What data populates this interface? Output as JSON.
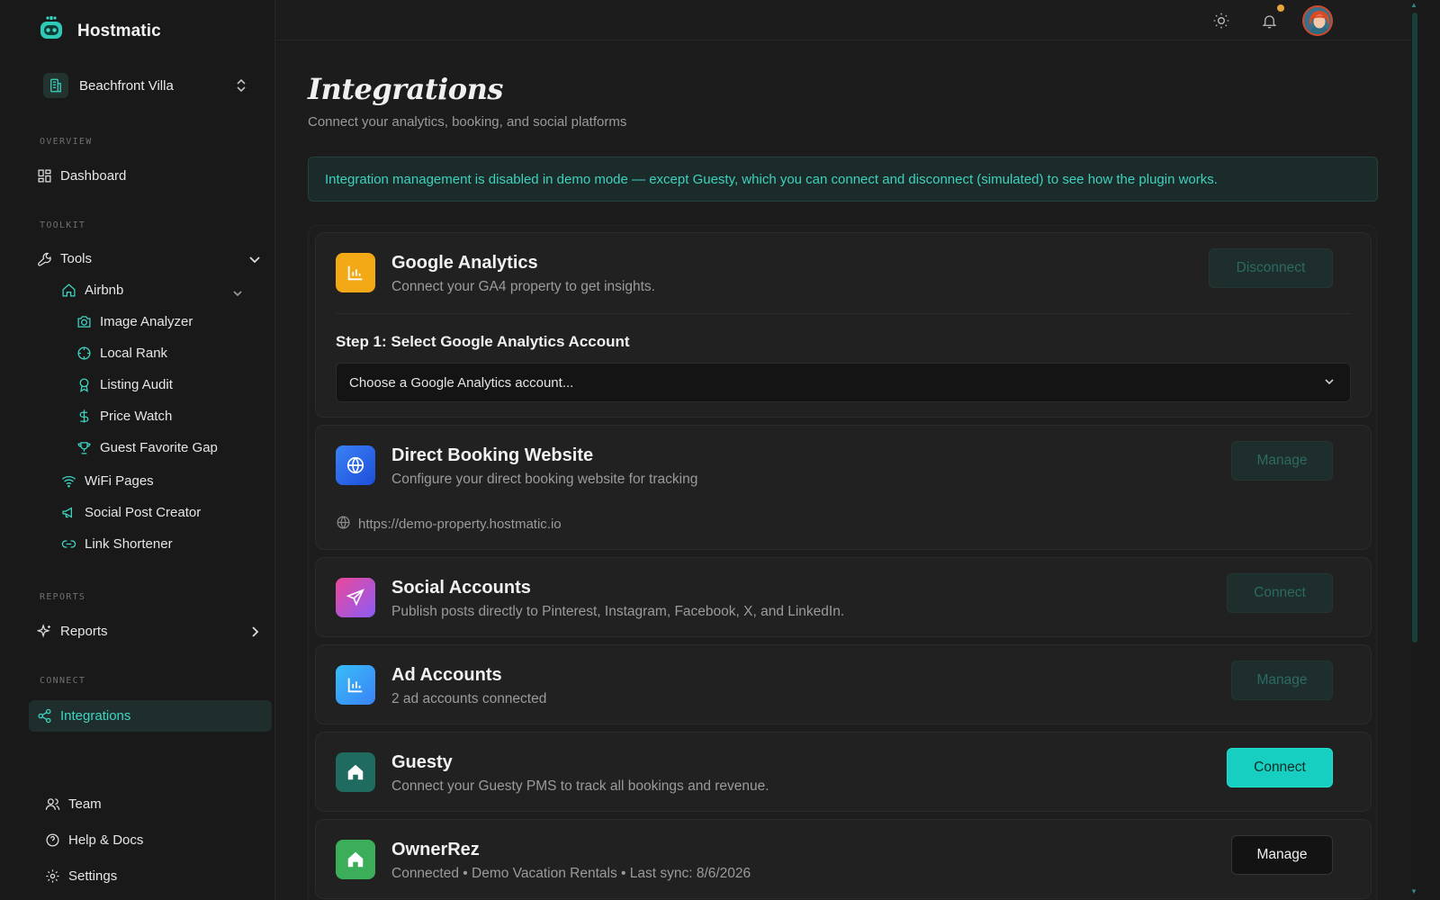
{
  "app": {
    "name": "Hostmatic"
  },
  "property": {
    "name": "Beachfront Villa"
  },
  "sidebar": {
    "sections": {
      "overview": "OVERVIEW",
      "toolkit": "TOOLKIT",
      "reports": "REPORTS",
      "connect": "CONNECT"
    },
    "dashboard": "Dashboard",
    "tools": "Tools",
    "airbnb": "Airbnb",
    "airbnb_items": [
      "Image Analyzer",
      "Local Rank",
      "Listing Audit",
      "Price Watch",
      "Guest Favorite Gap"
    ],
    "tool_items": [
      "WiFi Pages",
      "Social Post Creator",
      "Link Shortener"
    ],
    "reports": "Reports",
    "integrations": "Integrations",
    "footer": [
      "Team",
      "Help & Docs",
      "Settings"
    ]
  },
  "page": {
    "title": "Integrations",
    "subtitle": "Connect your analytics, booking, and social platforms",
    "banner": "Integration management is disabled in demo mode — except Guesty, which you can connect and disconnect (simulated) to see how the plugin works."
  },
  "integrations": {
    "google": {
      "title": "Google Analytics",
      "desc": "Connect your GA4 property to get insights.",
      "button": "Disconnect",
      "step": "Step 1: Select Google Analytics Account",
      "select_value": "Choose a Google Analytics account..."
    },
    "direct": {
      "title": "Direct Booking Website",
      "desc": "Configure your direct booking website for tracking",
      "button": "Manage",
      "url": "https://demo-property.hostmatic.io"
    },
    "social": {
      "title": "Social Accounts",
      "desc": "Publish posts directly to Pinterest, Instagram, Facebook, X, and LinkedIn.",
      "button": "Connect"
    },
    "ads": {
      "title": "Ad Accounts",
      "desc": "2 ad accounts connected",
      "button": "Manage"
    },
    "guesty": {
      "title": "Guesty",
      "desc": "Connect your Guesty PMS to track all bookings and revenue.",
      "button": "Connect"
    },
    "ownerrez": {
      "title": "OwnerRez",
      "desc": "Connected • Demo Vacation Rentals • Last sync: 8/6/2026",
      "button": "Manage"
    }
  },
  "colors": {
    "accent": "#17cfc1",
    "background": "#1c1c1c",
    "sidebar": "#191919",
    "notification_dot": "#e9a43c"
  }
}
